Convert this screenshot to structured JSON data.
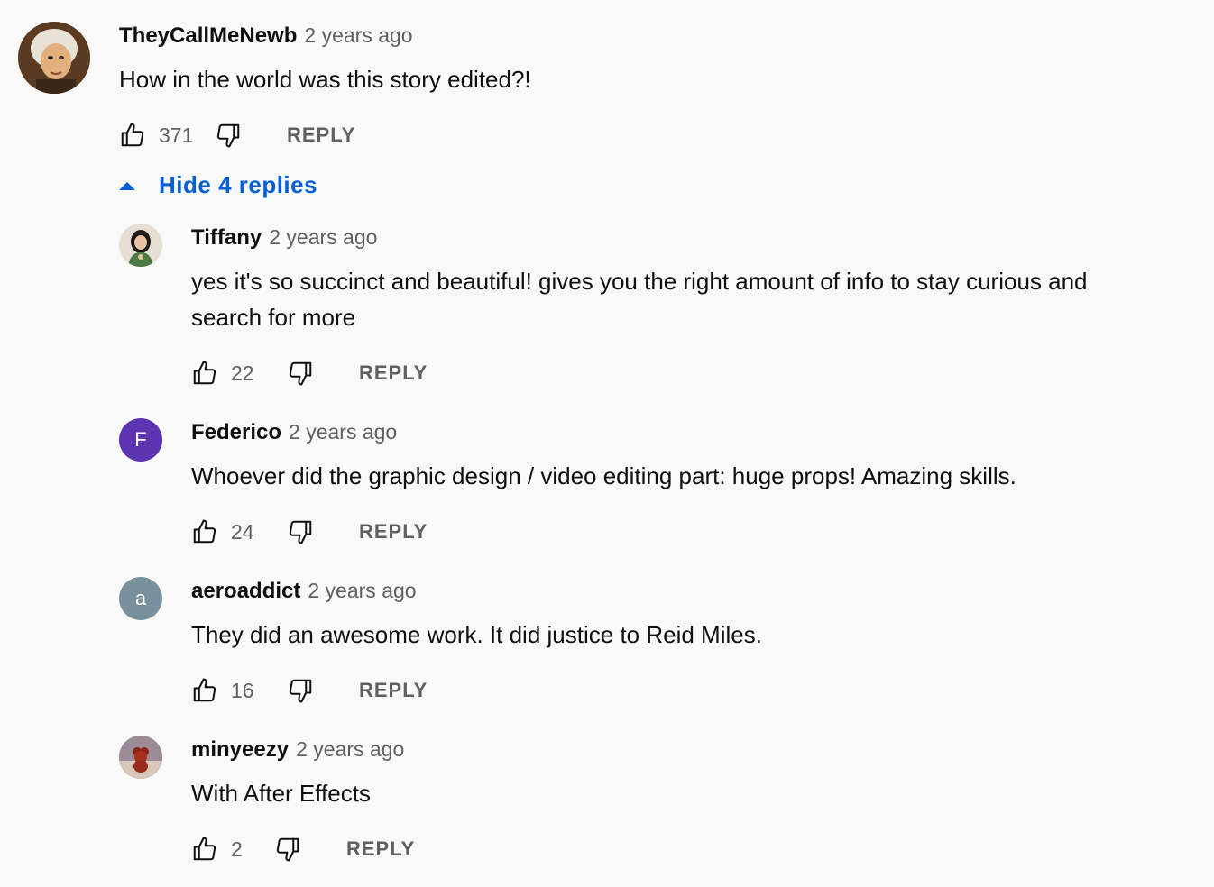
{
  "top_comment": {
    "author": "TheyCallMeNewb",
    "time": "2 years ago",
    "text": "How in the world was this story edited?!",
    "likes": "371",
    "reply_label": "REPLY"
  },
  "replies_toggle": {
    "label": "Hide 4 replies",
    "icon": "caret-up-icon"
  },
  "replies": [
    {
      "author": "Tiffany",
      "time": "2 years ago",
      "text_line1": "yes it's so succinct and beautiful! gives you the right amount of info to stay curious and",
      "text_line2": "search for more",
      "likes": "22",
      "reply_label": "REPLY"
    },
    {
      "author": "Federico",
      "time": "2 years ago",
      "avatar_letter": "F",
      "avatar_color": "#5e35b1",
      "text": "Whoever did the graphic design / video editing part: huge props! Amazing skills.",
      "likes": "24",
      "reply_label": "REPLY"
    },
    {
      "author": "aeroaddict",
      "time": "2 years ago",
      "avatar_letter": "a",
      "avatar_color": "#78909c",
      "text": "They did an awesome work. It did justice to Reid Miles.",
      "likes": "16",
      "reply_label": "REPLY"
    },
    {
      "author": "minyeezy",
      "time": "2 years ago",
      "text": "With After Effects",
      "likes": "2",
      "reply_label": "REPLY"
    }
  ],
  "colors": {
    "background": "#f9f9f9",
    "link_blue": "#065fd4",
    "muted": "#606060"
  }
}
